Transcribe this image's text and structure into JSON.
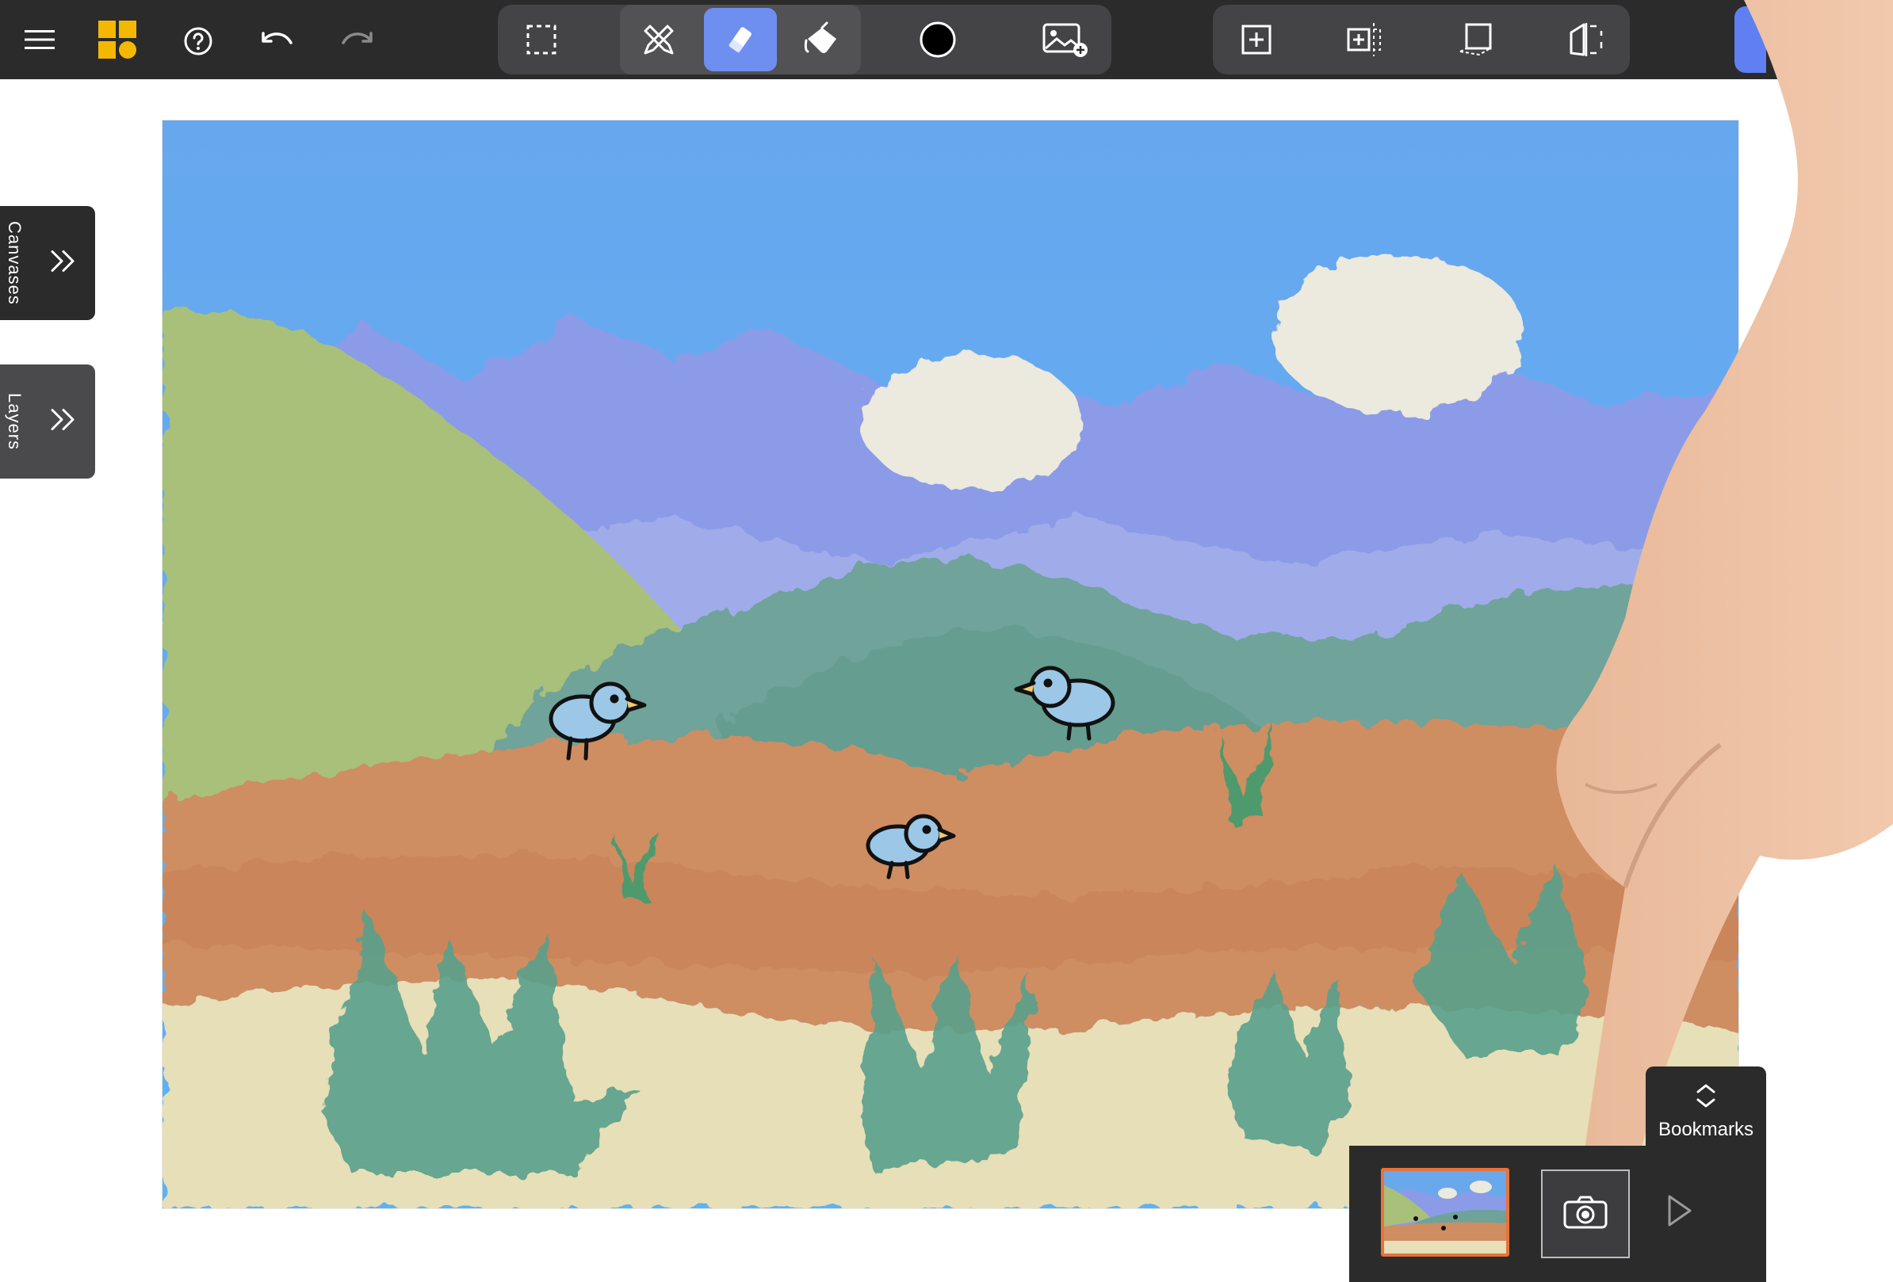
{
  "toolbar": {
    "left": [
      {
        "name": "menu-icon"
      },
      {
        "name": "app-logo-icon"
      },
      {
        "name": "help-icon"
      },
      {
        "name": "undo-icon"
      },
      {
        "name": "redo-icon"
      }
    ],
    "tools": [
      {
        "name": "selection-tool-icon"
      },
      {
        "name": "pen-pencil-tool-icon"
      },
      {
        "name": "eraser-tool-icon",
        "active": true
      },
      {
        "name": "fill-bucket-tool-icon"
      },
      {
        "name": "color-swatch-icon"
      },
      {
        "name": "insert-image-icon"
      }
    ],
    "canvas_tools": [
      {
        "name": "add-canvas-icon"
      },
      {
        "name": "resize-canvas-icon"
      },
      {
        "name": "transform-canvas-icon"
      },
      {
        "name": "flip-canvas-icon"
      }
    ],
    "colors": {
      "bar": "#2b2b2b",
      "group": "#444446",
      "active": "#6f8ff0",
      "logo": "#f5b800",
      "current_color": "#000000"
    }
  },
  "side_tabs": {
    "canvases": {
      "label": "Canvases"
    },
    "layers": {
      "label": "Layers"
    }
  },
  "bookmarks": {
    "label": "Bookmarks",
    "thumbnail_border": "#e8723a"
  }
}
